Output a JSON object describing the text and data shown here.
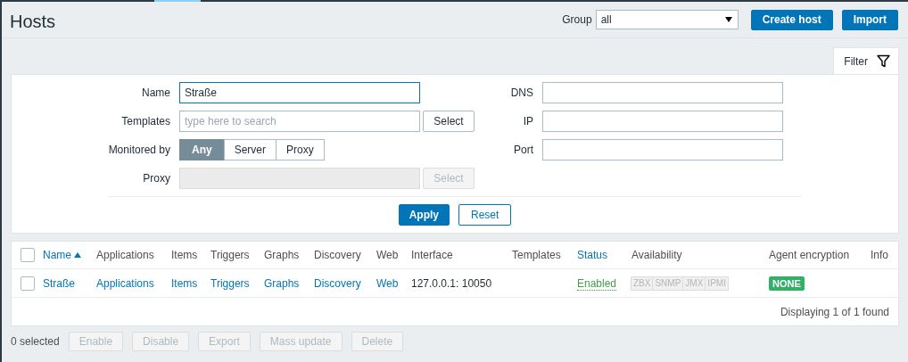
{
  "header": {
    "title": "Hosts",
    "group_label": "Group",
    "group_value": "all",
    "buttons": [
      "Create host",
      "Import"
    ]
  },
  "filter": {
    "tab_label": "Filter",
    "expanded": true,
    "name": {
      "label": "Name",
      "value": "Straße"
    },
    "templates": {
      "label": "Templates",
      "placeholder": "type here to search",
      "button": "Select"
    },
    "monitored_by": {
      "label": "Monitored by",
      "options": [
        {
          "label": "Any",
          "selected": true
        },
        {
          "label": "Server",
          "selected": false
        },
        {
          "label": "Proxy",
          "selected": false
        }
      ]
    },
    "proxy": {
      "label": "Proxy",
      "button": "Select",
      "disabled": true
    },
    "dns": {
      "label": "DNS"
    },
    "ip": {
      "label": "IP"
    },
    "port": {
      "label": "Port"
    },
    "apply": "Apply",
    "reset": "Reset"
  },
  "table": {
    "select_all_checked": false,
    "columns": [
      {
        "label": "Name",
        "sortable": true,
        "sorted": true
      },
      {
        "label": "Applications",
        "sortable": false,
        "sorted": false
      },
      {
        "label": "Items",
        "sortable": false,
        "sorted": false
      },
      {
        "label": "Triggers",
        "sortable": false,
        "sorted": false
      },
      {
        "label": "Graphs",
        "sortable": false,
        "sorted": false
      },
      {
        "label": "Discovery",
        "sortable": false,
        "sorted": false
      },
      {
        "label": "Web",
        "sortable": false,
        "sorted": false
      },
      {
        "label": "Interface",
        "sortable": false,
        "sorted": false
      },
      {
        "label": "Templates",
        "sortable": false,
        "sorted": false
      },
      {
        "label": "Status",
        "sortable": true,
        "sorted": false
      },
      {
        "label": "Availability",
        "sortable": false,
        "sorted": false
      },
      {
        "label": "Agent encryption",
        "sortable": false,
        "sorted": false
      },
      {
        "label": "Info",
        "sortable": false,
        "sorted": false
      }
    ],
    "rows": [
      {
        "checked": false,
        "name": "Straße",
        "applications": "Applications",
        "items": "Items",
        "triggers": "Triggers",
        "graphs": "Graphs",
        "discovery": "Discovery",
        "web": "Web",
        "interface": "127.0.0.1: 10050",
        "status": "Enabled",
        "enabled": true,
        "availability": [
          {
            "label": "ZBX",
            "on": false
          },
          {
            "label": "SNMP",
            "on": false
          },
          {
            "label": "JMX",
            "on": false
          },
          {
            "label": "IPMI",
            "on": false
          }
        ],
        "encryption": "NONE"
      }
    ],
    "footer": "Displaying 1 of 1 found"
  },
  "actions": {
    "selected": "0 selected",
    "buttons": [
      "Enable",
      "Disable",
      "Export",
      "Mass update",
      "Delete"
    ]
  }
}
